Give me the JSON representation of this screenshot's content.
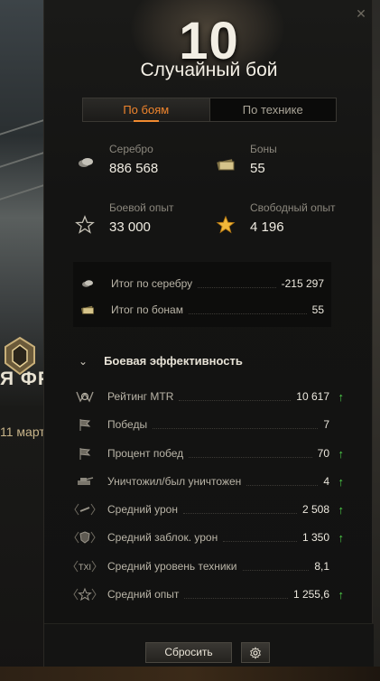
{
  "background": {
    "left_text_1": "Я ФРО",
    "left_text_2": "11 март"
  },
  "header": {
    "level": "10",
    "title": "Случайный бой"
  },
  "tabs": [
    {
      "label": "По боям",
      "active": true
    },
    {
      "label": "По технике",
      "active": false
    }
  ],
  "stats": {
    "silver": {
      "label": "Серебро",
      "value": "886 568",
      "icon": "silver-icon"
    },
    "bonds": {
      "label": "Боны",
      "value": "55",
      "icon": "bonds-icon"
    },
    "battle_xp": {
      "label": "Боевой опыт",
      "value": "33 000",
      "icon": "star-outline-icon"
    },
    "free_xp": {
      "label": "Свободный опыт",
      "value": "4 196",
      "icon": "star-filled-icon"
    }
  },
  "totals": [
    {
      "label": "Итог по серебру",
      "value": "-215 297",
      "icon": "silver-icon"
    },
    {
      "label": "Итог по бонам",
      "value": "55",
      "icon": "bonds-icon"
    }
  ],
  "efficiency": {
    "title": "Боевая эффективность",
    "rows": [
      {
        "label": "Рейтинг MTR",
        "value": "10 617",
        "trend": "up",
        "icon": "mtr-rating-icon"
      },
      {
        "label": "Победы",
        "value": "7",
        "trend": "",
        "icon": "victory-flag-icon"
      },
      {
        "label": "Процент побед",
        "value": "70",
        "trend": "up",
        "icon": "win-rate-flag-icon"
      },
      {
        "label": "Уничтожил/был уничтожен",
        "value": "4",
        "trend": "up",
        "icon": "kd-ratio-icon"
      },
      {
        "label": "Средний урон",
        "value": "2 508",
        "trend": "up",
        "icon": "damage-icon"
      },
      {
        "label": "Средний заблок. урон",
        "value": "1 350",
        "trend": "up",
        "icon": "blocked-damage-icon"
      },
      {
        "label": "Средний уровень техники",
        "value": "8,1",
        "trend": "",
        "icon": "tier-icon"
      },
      {
        "label": "Средний опыт",
        "value": "1 255,6",
        "trend": "up",
        "icon": "avg-xp-icon"
      }
    ]
  },
  "footer": {
    "reset_label": "Сбросить",
    "settings_icon": "gear-icon"
  },
  "colors": {
    "accent_orange": "#f08a30",
    "trend_up_green": "#4fd34a"
  }
}
